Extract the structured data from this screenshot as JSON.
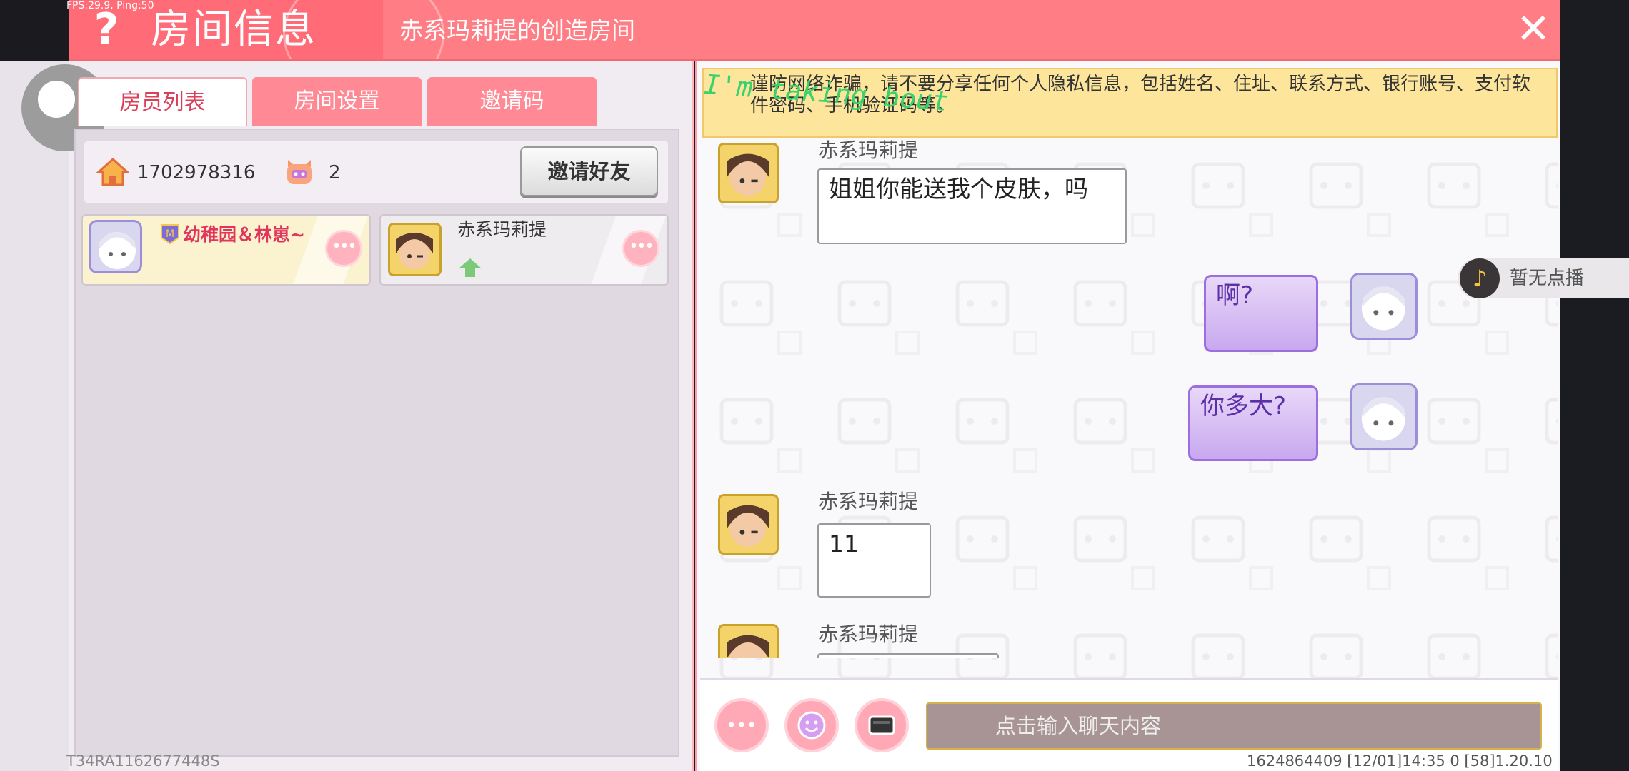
{
  "status": {
    "fps": "FPS:29.9, Ping:50"
  },
  "header": {
    "title": "房间信息",
    "subtitle": "赤系玛莉提的创造房间",
    "close": "✕",
    "help": "?"
  },
  "tabs": [
    {
      "label": "房员列表",
      "active": true
    },
    {
      "label": "房间设置",
      "active": false
    },
    {
      "label": "邀请码",
      "active": false
    }
  ],
  "room": {
    "id": "1702978316",
    "member_count": "2",
    "invite_label": "邀请好友"
  },
  "members": [
    {
      "name": "幼稚园＆林崽~",
      "avatar": "white-hair-avatar",
      "highlight": true
    },
    {
      "name": "赤系玛莉提",
      "avatar": "brown-hair-avatar",
      "highlight": false
    }
  ],
  "notice": {
    "text": "谨防网络诈骗，请不要分享任何个人隐私信息，包括姓名、住址、联系方式、银行账号、支付软件密码、手机验证码等。"
  },
  "overlay": {
    "text": "I'm taking bout"
  },
  "messages": [
    {
      "sender": "赤系玛莉提",
      "text": "姐姐你能送我个皮肤，吗",
      "side": "left"
    },
    {
      "sender": "",
      "text": "啊?",
      "side": "right"
    },
    {
      "sender": "",
      "text": "你多大?",
      "side": "right"
    },
    {
      "sender": "赤系玛莉提",
      "text": "11",
      "side": "left"
    },
    {
      "sender": "赤系玛莉提",
      "text": "",
      "side": "left"
    }
  ],
  "music": {
    "label": "暂无点播",
    "icon": "music-note-icon"
  },
  "chat_input": {
    "placeholder": "点击输入聊天内容"
  },
  "buttons": {
    "more": "•••"
  },
  "footer": {
    "left": "T34RA1162677448S",
    "right": "1624864409   [12/01]14:35 0   [58]1.20.10"
  },
  "colors": {
    "accent": "#ff7d85",
    "highlight_name": "#e0355c",
    "notice_bg": "#fde59b"
  }
}
